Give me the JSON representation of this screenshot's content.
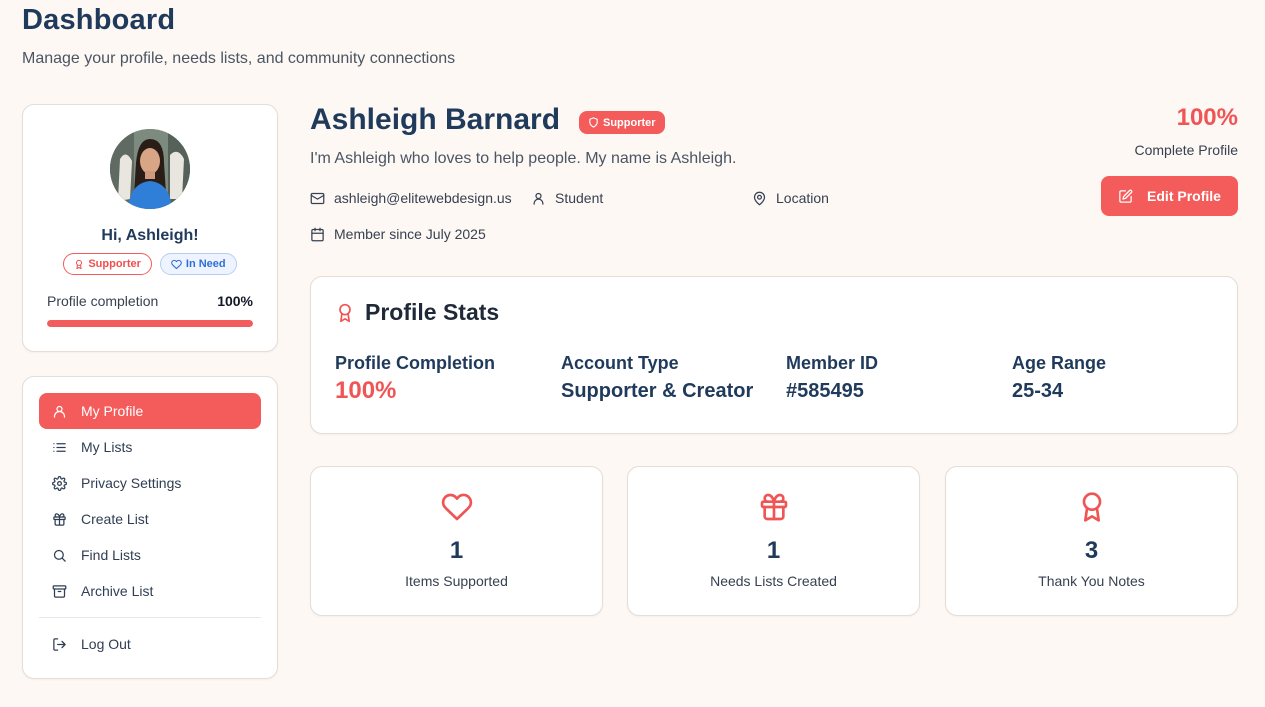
{
  "page": {
    "title": "Dashboard",
    "subtitle": "Manage your profile, needs lists, and community connections"
  },
  "sidebar": {
    "greeting": "Hi, Ashleigh!",
    "badges": [
      {
        "label": "Supporter",
        "icon": "award-icon"
      },
      {
        "label": "In Need",
        "icon": "heart-icon"
      }
    ],
    "completion_label": "Profile completion",
    "completion_value": "100%",
    "completion_fraction": 1.0,
    "nav": [
      {
        "label": "My Profile",
        "icon": "user-icon",
        "active": true
      },
      {
        "label": "My Lists",
        "icon": "list-icon"
      },
      {
        "label": "Privacy Settings",
        "icon": "gear-icon"
      },
      {
        "label": "Create List",
        "icon": "gift-icon"
      },
      {
        "label": "Find Lists",
        "icon": "search-icon"
      },
      {
        "label": "Archive List",
        "icon": "archive-icon"
      },
      {
        "label": "Log Out",
        "icon": "logout-icon"
      }
    ]
  },
  "profile": {
    "name": "Ashleigh Barnard",
    "role_badge": "Supporter",
    "bio": "I'm Ashleigh who loves to help people. My name is Ashleigh.",
    "email": "ashleigh@elitewebdesign.us",
    "occupation": "Student",
    "location": "Location",
    "member_since": "Member since July 2025",
    "completion_value": "100%",
    "completion_label": "Complete Profile",
    "edit_label": "Edit Profile"
  },
  "stats": {
    "title": "Profile Stats",
    "items": [
      {
        "label": "Profile Completion",
        "value": "100%"
      },
      {
        "label": "Account Type",
        "value": "Supporter & Creator"
      },
      {
        "label": "Member ID",
        "value": "#585495"
      },
      {
        "label": "Age Range",
        "value": "25-34"
      }
    ]
  },
  "summary": [
    {
      "value": "1",
      "label": "Items Supported",
      "icon": "heart-icon"
    },
    {
      "value": "1",
      "label": "Needs Lists Created",
      "icon": "gift-icon"
    },
    {
      "value": "3",
      "label": "Thank You Notes",
      "icon": "award-icon"
    }
  ],
  "colors": {
    "accent": "#f45b5b",
    "navy": "#1f3a5a",
    "background": "#fdf8f4",
    "info_blue": "#2f6fd6"
  }
}
